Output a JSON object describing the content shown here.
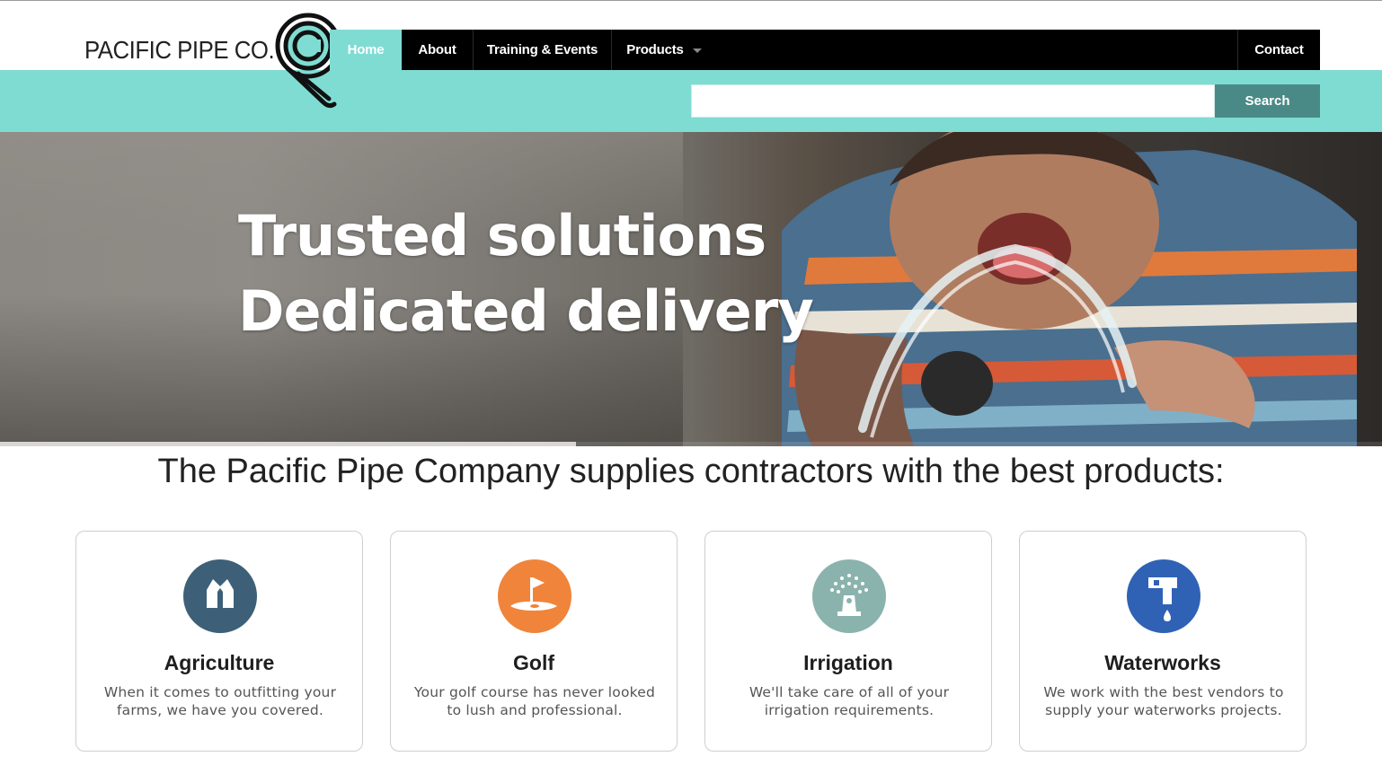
{
  "brand": {
    "name": "PACIFIC PIPE CO.",
    "mark_color": "#111111",
    "accent_teal": "#7fdcd3"
  },
  "nav": {
    "items": [
      {
        "label": "Home",
        "active": true
      },
      {
        "label": "About"
      },
      {
        "label": "Training & Events"
      },
      {
        "label": "Products",
        "has_dropdown": true
      },
      {
        "label": "Contact"
      }
    ]
  },
  "search": {
    "value": "",
    "placeholder": "",
    "button_label": "Search"
  },
  "hero": {
    "line1": "Trusted solutions",
    "line2": "Dedicated delivery",
    "slide_progress": 0.417
  },
  "tagline": "The Pacific Pipe Company supplies contractors with the best products:",
  "cards": [
    {
      "title": "Agriculture",
      "description": "When it comes to outfitting your farms, we have you covered.",
      "icon": "barn-icon",
      "color": "#3d6078"
    },
    {
      "title": "Golf",
      "description": "Your golf course has never looked to lush and professional.",
      "icon": "golf-flag-icon",
      "color": "#f0843a"
    },
    {
      "title": "Irrigation",
      "description": "We'll take care of all of your irrigation requirements.",
      "icon": "sprinkler-icon",
      "color": "#8bb3ad"
    },
    {
      "title": "Waterworks",
      "description": "We work with the best vendors to supply your waterworks projects.",
      "icon": "faucet-icon",
      "color": "#2f62b5"
    }
  ]
}
